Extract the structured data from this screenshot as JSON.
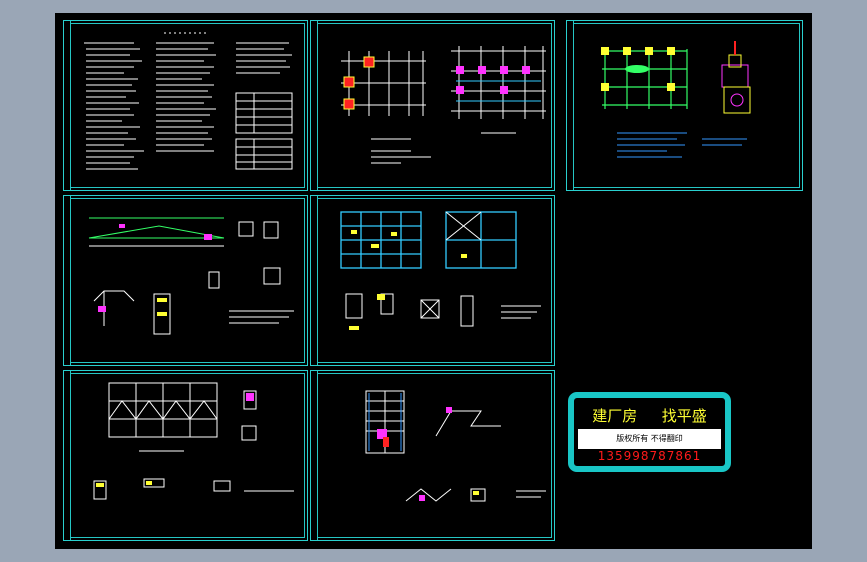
{
  "stamp": {
    "title_left": "建厂房",
    "title_right": "找平盛",
    "subtitle": "版权所有 不得翻印",
    "phone": "135998787861"
  },
  "colors": {
    "page_background": "#9aa6b6",
    "canvas_background": "#000000",
    "frame_cyan": "#2ad0cf",
    "line_white": "#ffffff",
    "accent_magenta": "#ff33ff",
    "accent_yellow": "#ffff33",
    "accent_green": "#33ff66",
    "accent_red": "#ff2222",
    "accent_blue": "#3399ff"
  },
  "sheets": [
    {
      "id": "general-notes",
      "kind": "text"
    },
    {
      "id": "foundation-plan",
      "kind": "grid"
    },
    {
      "id": "foundation-detail",
      "kind": "plan-detail"
    },
    {
      "id": "roof-truss",
      "kind": "truss"
    },
    {
      "id": "beam-plan",
      "kind": "grid"
    },
    {
      "id": "roof-bracing",
      "kind": "bracing"
    },
    {
      "id": "stair-detail",
      "kind": "stair"
    }
  ]
}
